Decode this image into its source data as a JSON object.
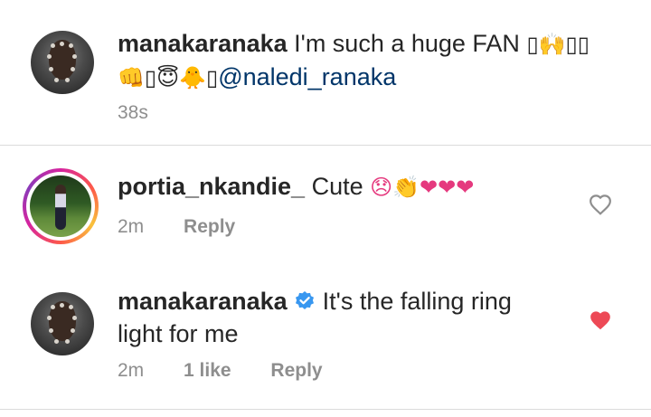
{
  "comments": [
    {
      "username": "manakaranaka",
      "text_line1": "I'm such a huge FAN",
      "line1_emojis": "▯🙌▯▯",
      "line2_emojis": "👊▯😇🐥▯",
      "mention": "@naledi_ranaka",
      "time": "38s"
    },
    {
      "username": "portia_nkandie_",
      "text": "Cute",
      "emojis": "😞👏❤❤❤",
      "time": "2m",
      "reply_label": "Reply",
      "liked": false
    },
    {
      "username": "manakaranaka",
      "text_line1": "It's the falling ring",
      "text_line2": "light for me",
      "time": "2m",
      "likes_label": "1 like",
      "reply_label": "Reply",
      "liked": true,
      "verified": true
    }
  ],
  "colors": {
    "heart_liked": "#ed4956",
    "heart_outline": "#8e8e8e",
    "verified": "#3897f0",
    "mention": "#003569"
  }
}
